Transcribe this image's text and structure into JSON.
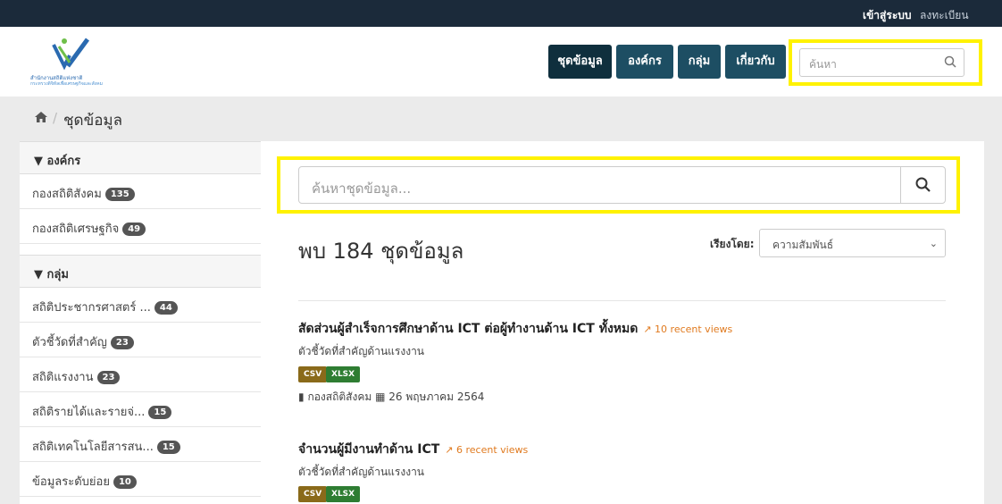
{
  "topbar": {
    "login": "เข้าสู่ระบบ",
    "register": "ลงทะเบียน"
  },
  "logo": {
    "line1": "สำนักงานสถิติแห่งชาติ",
    "line2": "กระทรวงดิจิทัลเพื่อเศรษฐกิจและสังคม"
  },
  "nav": {
    "dataset": "ชุดข้อมูล",
    "organization": "องค์กร",
    "group": "กลุ่ม",
    "about": "เกี่ยวกับ"
  },
  "header_search": {
    "placeholder": "ค้นหา"
  },
  "breadcrumb": {
    "current": "ชุดข้อมูล"
  },
  "sidebar": {
    "org_title": "องค์กร",
    "orgs": [
      {
        "label": "กองสถิติสังคม",
        "count": "135"
      },
      {
        "label": "กองสถิติเศรษฐกิจ",
        "count": "49"
      }
    ],
    "group_title": "กลุ่ม",
    "groups": [
      {
        "label": "สถิติประชากรศาสตร์ ...",
        "count": "44"
      },
      {
        "label": "ตัวชี้วัดที่สำคัญ",
        "count": "23"
      },
      {
        "label": "สถิติแรงงาน",
        "count": "23"
      },
      {
        "label": "สถิติรายได้และรายจ่...",
        "count": "15"
      },
      {
        "label": "สถิติเทคโนโลยีสารสน...",
        "count": "15"
      },
      {
        "label": "ข้อมูลระดับย่อย",
        "count": "10"
      }
    ]
  },
  "main": {
    "search_placeholder": "ค้นหาชุดข้อมูล...",
    "result_count": "พบ 184 ชุดข้อมูล",
    "sort_label": "เรียงโดย:",
    "sort_value": "ความสัมพันธ์",
    "datasets": [
      {
        "title": "สัดส่วนผู้สำเร็จการศึกษาด้าน ICT ต่อผู้ทำงานด้าน ICT ทั้งหมด",
        "views": "10 recent views",
        "desc": "ตัวชี้วัดที่สำคัญด้านแรงงาน",
        "formats": [
          "CSV",
          "XLSX"
        ],
        "org": "กองสถิติสังคม",
        "date": "26 พฤษภาคม 2564"
      },
      {
        "title": "จำนวนผู้มีงานทำด้าน ICT",
        "views": "6 recent views",
        "desc": "ตัวชี้วัดที่สำคัญด้านแรงงาน",
        "formats": [
          "CSV",
          "XLSX"
        ]
      }
    ]
  },
  "colors": {
    "topbar": "#1b2a3a",
    "nav": "#1d4e63",
    "nav_active": "#0f2f3d",
    "highlight": "#fff200"
  }
}
